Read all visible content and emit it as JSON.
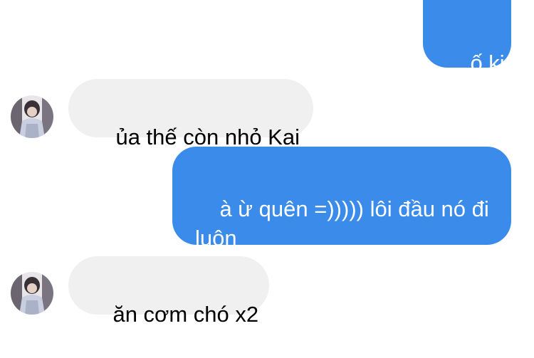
{
  "messages": [
    {
      "direction": "sent",
      "text": "ố ki"
    },
    {
      "direction": "received",
      "text": "ủa thế còn nhỏ Kai",
      "avatar": "contact-avatar-photo"
    },
    {
      "direction": "sent",
      "text": "à ừ quên =))))) lôi đầu nó đi luôn"
    },
    {
      "direction": "received",
      "text": "ăn cơm chó x2",
      "avatar": "contact-avatar-photo"
    }
  ],
  "colors": {
    "sent_bubble": "#3b8bea",
    "received_bubble": "#f0f0f0",
    "background": "#ffffff"
  }
}
